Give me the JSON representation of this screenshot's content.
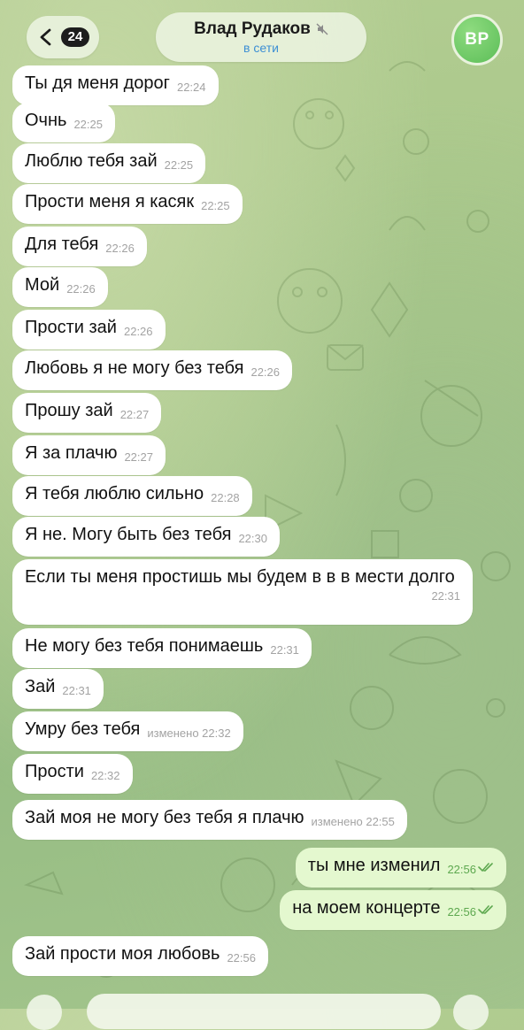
{
  "header": {
    "back_badge": "24",
    "contact_name": "Влад Рудаков",
    "status": "в сети",
    "avatar_initials": "ВР"
  },
  "messages": [
    {
      "text": "Ты дя меня дорог",
      "time": "22:24",
      "dir": "in"
    },
    {
      "text": "Очнь",
      "time": "22:25",
      "dir": "in"
    },
    {
      "text": "Люблю тебя зай",
      "time": "22:25",
      "dir": "in"
    },
    {
      "text": "Прости меня я касяк",
      "time": "22:25",
      "dir": "in"
    },
    {
      "text": "Для тебя",
      "time": "22:26",
      "dir": "in"
    },
    {
      "text": "Мой",
      "time": "22:26",
      "dir": "in"
    },
    {
      "text": "Прости зай",
      "time": "22:26",
      "dir": "in"
    },
    {
      "text": "Любовь я не могу без тебя",
      "time": "22:26",
      "dir": "in"
    },
    {
      "text": "Прошу зай",
      "time": "22:27",
      "dir": "in"
    },
    {
      "text": "Я за плачю",
      "time": "22:27",
      "dir": "in"
    },
    {
      "text": "Я тебя люблю сильно",
      "time": "22:28",
      "dir": "in"
    },
    {
      "text": "Я не. Могу быть без тебя",
      "time": "22:30",
      "dir": "in"
    },
    {
      "text": "Если ты меня простишь мы будем в в в мести долго",
      "time": "22:31",
      "dir": "in"
    },
    {
      "text": "Не могу без тебя понимаешь",
      "time": "22:31",
      "dir": "in"
    },
    {
      "text": "Зай",
      "time": "22:31",
      "dir": "in"
    },
    {
      "text": "Умру без тебя",
      "time": "изменено 22:32",
      "dir": "in"
    },
    {
      "text": "Прости",
      "time": "22:32",
      "dir": "in"
    },
    {
      "text": "Зай моя не могу без тебя я плачю",
      "time": "изменено 22:55",
      "dir": "in"
    },
    {
      "text": "ты мне изменил",
      "time": "22:56",
      "dir": "out"
    },
    {
      "text": "на моем концерте",
      "time": "22:56",
      "dir": "out"
    },
    {
      "text": "Зай прости моя любовь",
      "time": "22:56",
      "dir": "in"
    }
  ],
  "icons": {
    "back": "chevron-left-icon",
    "mute": "mute-icon",
    "read": "double-check-icon"
  },
  "colors": {
    "incoming_bubble": "#ffffff",
    "outgoing_bubble": "#e4f8cf",
    "status": "#3d8fd4",
    "avatar": "#5cbe58",
    "checks": "#5da84f"
  }
}
